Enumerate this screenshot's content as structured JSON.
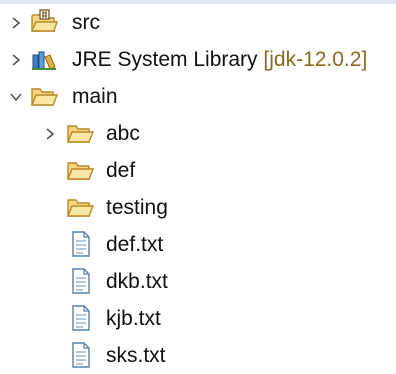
{
  "tree": {
    "items": [
      {
        "label": "src"
      },
      {
        "label": "JRE System Library",
        "decoration": "[jdk-12.0.2]"
      },
      {
        "label": "main"
      },
      {
        "label": "abc"
      },
      {
        "label": "def"
      },
      {
        "label": "testing"
      },
      {
        "label": "def.txt"
      },
      {
        "label": "dkb.txt"
      },
      {
        "label": "kjb.txt"
      },
      {
        "label": "sks.txt"
      }
    ]
  },
  "colors": {
    "folder_fill": "#f6d580",
    "folder_stroke": "#b8892b",
    "chevron": "#555555",
    "decoration_text": "#8a6a1e",
    "file_stroke": "#5b7fa8"
  }
}
